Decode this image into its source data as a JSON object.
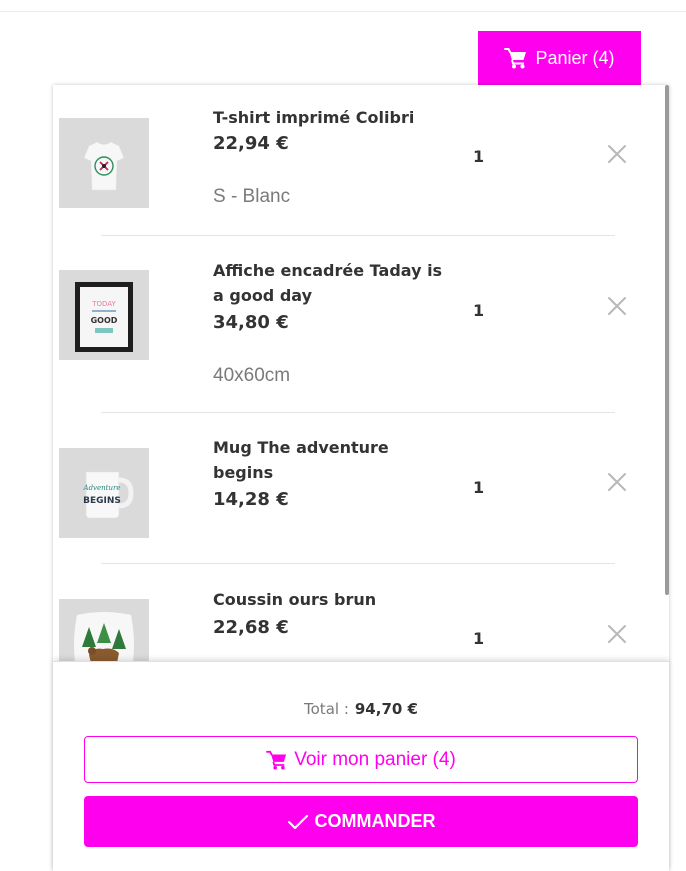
{
  "cart_trigger": {
    "label": "Panier (4)",
    "icon": "cart-icon"
  },
  "items": [
    {
      "name": "T-shirt imprimé Colibri",
      "price": "22,94 €",
      "attribute": "S - Blanc",
      "quantity": "1",
      "thumb": "tshirt-thumbnail"
    },
    {
      "name": "Affiche encadrée Taday is a good day",
      "price": "34,80 €",
      "attribute": "40x60cm",
      "quantity": "1",
      "thumb": "framed-poster-thumbnail"
    },
    {
      "name": "Mug The adventure begins",
      "price": "14,28 €",
      "attribute": "",
      "quantity": "1",
      "thumb": "mug-thumbnail"
    },
    {
      "name": "Coussin ours brun",
      "price": "22,68 €",
      "attribute": "",
      "quantity": "1",
      "thumb": "cushion-thumbnail"
    }
  ],
  "footer": {
    "total_label": "Total :",
    "total_value": "94,70 €",
    "view_cart_label": "Voir mon panier (4)",
    "checkout_label": "COMMANDER"
  },
  "colors": {
    "accent": "#ff00ee",
    "text": "#333333",
    "muted": "#7a7a7a"
  }
}
